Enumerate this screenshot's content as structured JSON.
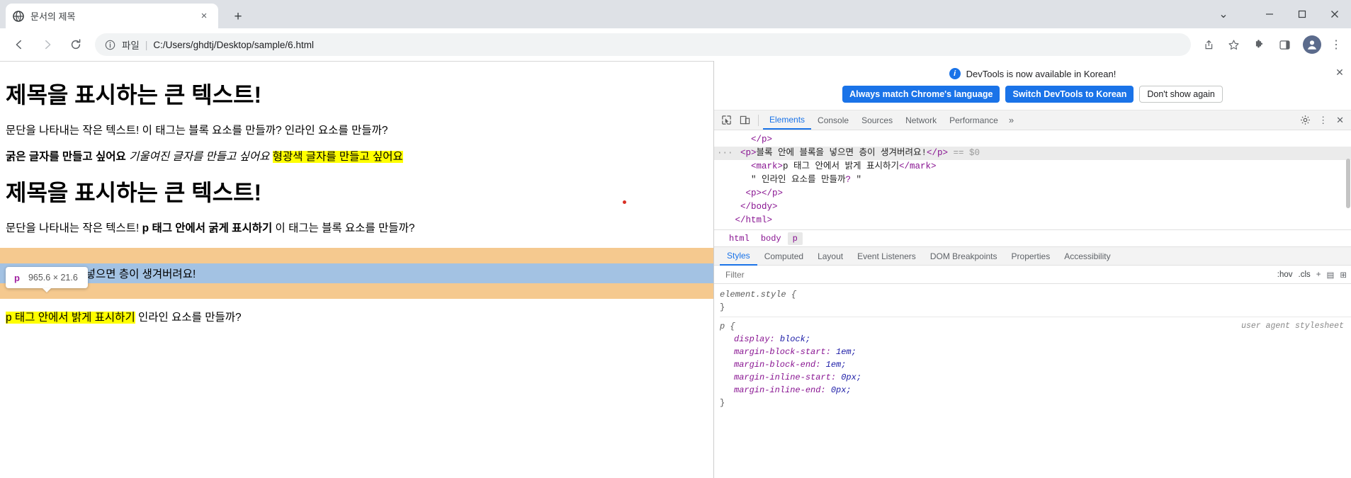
{
  "browser": {
    "tab": {
      "title": "문서의 제목",
      "favicon": "globe-icon",
      "close": "×"
    },
    "newtab_label": "+",
    "window_controls": {
      "caret": "⌄",
      "minimize": "—",
      "maximize": "▢",
      "close": "✕"
    },
    "toolbar": {
      "back": "←",
      "forward": "→",
      "reload": "⟳",
      "info": "ⓘ",
      "scheme_label": "파일",
      "separator": "|",
      "url": "C:/Users/ghdtj/Desktop/sample/6.html",
      "share": "share-icon",
      "bookmark": "★",
      "extensions": "puzzle-icon",
      "sidepanel": "panel-icon",
      "profile": "avatar",
      "menu": "⋮"
    }
  },
  "page": {
    "heading1": "제목을 표시하는 큰 텍스트!",
    "paragraph1": "문단을 나타내는 작은 텍스트! 이 태그는 블록 요소를 만들까? 인라인 요소를 만들까?",
    "styled_line": {
      "bold": "굵은 글자를 만들고 싶어요",
      "italic": "기울여진 글자를 만들고 싶어요",
      "mark": "형광색 글자를 만들고 싶어요"
    },
    "heading2": "제목을 표시하는 큰 텍스트!",
    "paragraph2": {
      "prefix": "문단을 나타내는 작은 텍스트!",
      "bold": "p 태그 안에서 굵게 표시하기",
      "suffix": "이 태그는 블록 요소를 만들까?"
    },
    "highlighted_block": "블록 안에 블록을 넣으면 층이 생겨버려요!",
    "paragraph3": {
      "mark": "p 태그 안에서 밝게 표시하기",
      "suffix": "인라인 요소를 만들까?"
    },
    "tooltip": {
      "tag": "p",
      "dimensions": "965.6 × 21.6"
    }
  },
  "devtools": {
    "notification": {
      "icon": "info-icon",
      "text": "DevTools is now available in Korean!",
      "buttons": [
        {
          "label": "Always match Chrome's language",
          "style": "primary"
        },
        {
          "label": "Switch DevTools to Korean",
          "style": "primary"
        },
        {
          "label": "Don't show again",
          "style": "secondary"
        }
      ],
      "close": "✕"
    },
    "toolbar": {
      "inspect": "inspect-icon",
      "device": "device-toolbar-icon",
      "tabs": [
        "Elements",
        "Console",
        "Sources",
        "Network",
        "Performance"
      ],
      "active_tab": "Elements",
      "overflow": "»",
      "settings": "gear-icon",
      "more": "⋮",
      "close": "✕"
    },
    "dom": [
      {
        "indent": 2,
        "html": "</p>",
        "selected": false,
        "dots": false
      },
      {
        "indent": 1,
        "html": "<p>블록 안에 블록을 넣으면 층이 생겨버려요!</p> == $0",
        "selected": true,
        "dots": true
      },
      {
        "indent": 2,
        "html": "<mark>p 태그 안에서 밝게 표시하기</mark>",
        "selected": false,
        "dots": false
      },
      {
        "indent": 2,
        "html": "\" 인라인 요소를 만들까? \"",
        "selected": false,
        "dots": false
      },
      {
        "indent": 2,
        "html": "<p></p>",
        "selected": false,
        "dots": false
      },
      {
        "indent": 1,
        "html": "</body>",
        "selected": false,
        "dots": false
      },
      {
        "indent": 0,
        "html": "</html>",
        "selected": false,
        "dots": false
      }
    ],
    "breadcrumbs": [
      "html",
      "body",
      "p"
    ],
    "breadcrumb_active": "p",
    "sidebar_tabs": [
      "Styles",
      "Computed",
      "Layout",
      "Event Listeners",
      "DOM Breakpoints",
      "Properties",
      "Accessibility"
    ],
    "sidebar_active": "Styles",
    "filter": {
      "placeholder": "Filter",
      "hov": ":hov",
      "cls": ".cls",
      "add": "+",
      "new_rule": "▤",
      "toggle": "⊞"
    },
    "styles_rules": [
      {
        "selector": "element.style {",
        "source": "",
        "declarations": [],
        "close": "}"
      },
      {
        "selector": "p {",
        "source": "user agent stylesheet",
        "declarations": [
          {
            "prop": "display:",
            "value": "block;"
          },
          {
            "prop": "margin-block-start:",
            "value": "1em;"
          },
          {
            "prop": "margin-block-end:",
            "value": "1em;"
          },
          {
            "prop": "margin-inline-start:",
            "value": "0px;"
          },
          {
            "prop": "margin-inline-end:",
            "value": "0px;"
          }
        ],
        "close": "}"
      }
    ]
  },
  "colors": {
    "accent": "#1a73e8",
    "mark": "#ffff00",
    "highlight_margin": "#f5c98f",
    "highlight_content": "#a3c2e3",
    "tag": "#881391"
  }
}
